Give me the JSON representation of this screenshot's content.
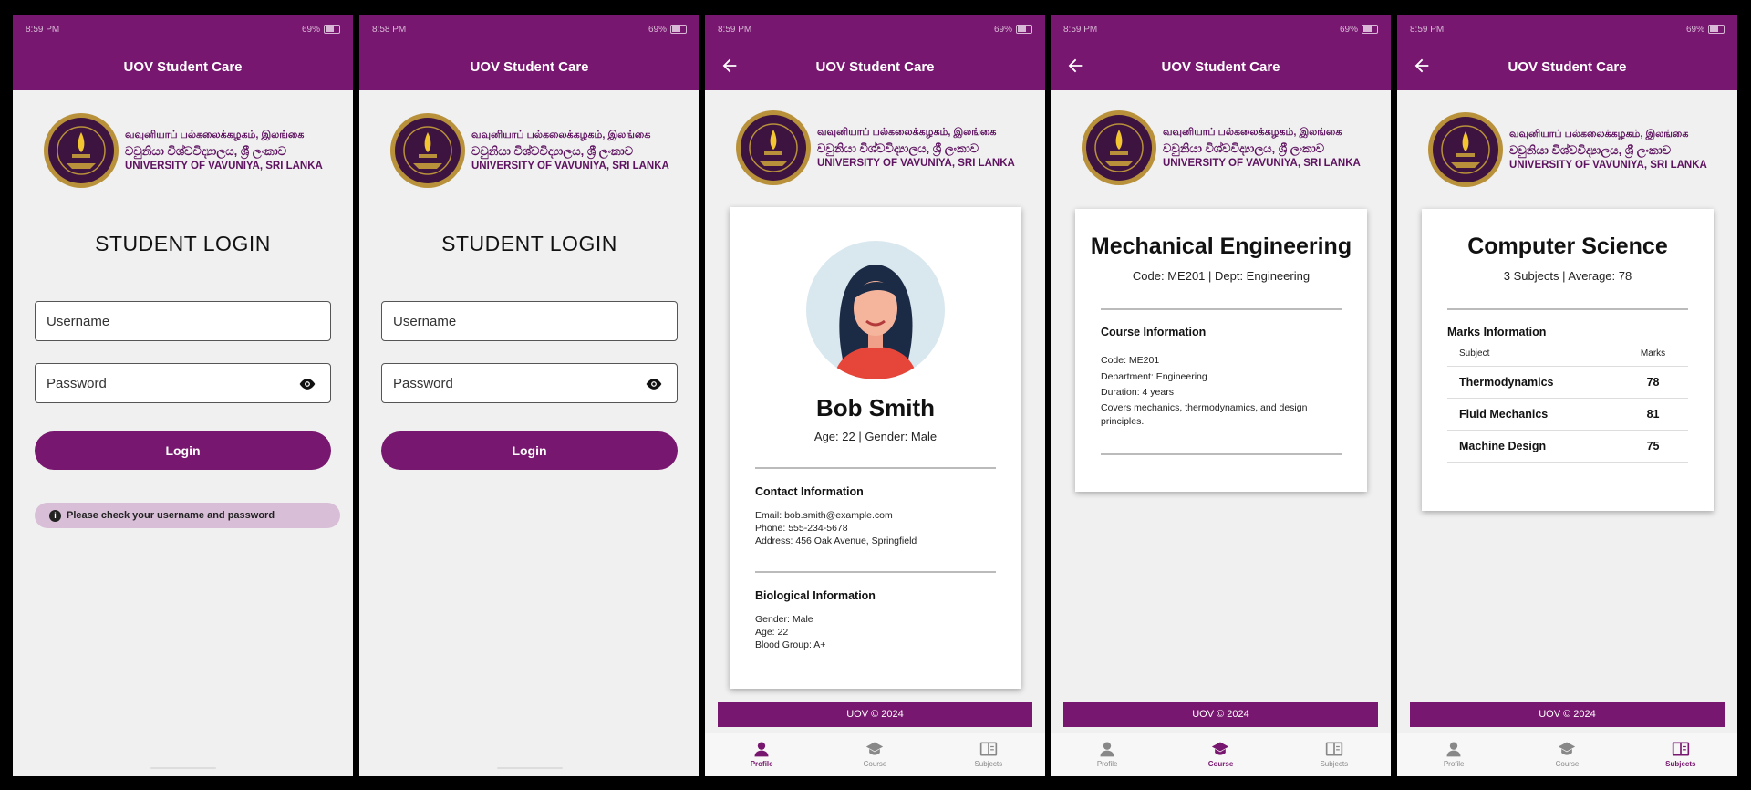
{
  "status_times": [
    "8:59 PM",
    "8:58 PM",
    "8:59 PM",
    "8:59 PM",
    "8:59 PM"
  ],
  "battery": "69%",
  "app_title": "UOV Student Care",
  "brand": {
    "line1": "வவுனியாப் பல்கலைக்கழகம், இலங்கை",
    "line2": "වවුනියා විශ්වවිද්‍යාලය, ශ්‍රී ලංකාව",
    "line3": "UNIVERSITY OF VAVUNIYA, SRI LANKA"
  },
  "login": {
    "title": "STUDENT LOGIN",
    "username_placeholder": "Username",
    "password_placeholder": "Password",
    "button": "Login",
    "error": "Please check your username and password"
  },
  "profile": {
    "name": "Bob Smith",
    "summary": "Age: 22 | Gender: Male",
    "contact_title": "Contact Information",
    "contact": [
      "Email: bob.smith@example.com",
      "Phone: 555-234-5678",
      "Address: 456 Oak Avenue, Springfield"
    ],
    "bio_title": "Biological Information",
    "bio": [
      "Gender: Male",
      "Age: 22",
      "Blood Group: A+"
    ]
  },
  "course": {
    "name": "Mechanical Engineering",
    "summary": "Code: ME201 | Dept: Engineering",
    "info_title": "Course Information",
    "info": [
      "Code: ME201",
      "Department: Engineering",
      "Duration: 4 years",
      "Covers mechanics, thermodynamics, and design principles."
    ]
  },
  "subjects": {
    "name": "Computer Science",
    "summary": "3 Subjects | Average: 78",
    "info_title": "Marks Information",
    "col_subject": "Subject",
    "col_marks": "Marks",
    "rows": [
      {
        "subject": "Thermodynamics",
        "marks": "78"
      },
      {
        "subject": "Fluid Mechanics",
        "marks": "81"
      },
      {
        "subject": "Machine Design",
        "marks": "75"
      }
    ]
  },
  "footer": "UOV © 2024",
  "nav": {
    "profile": "Profile",
    "course": "Course",
    "subjects": "Subjects"
  },
  "colors": {
    "primary": "#78176f",
    "toast": "#d8bfd7",
    "background": "#f0f0f0"
  }
}
